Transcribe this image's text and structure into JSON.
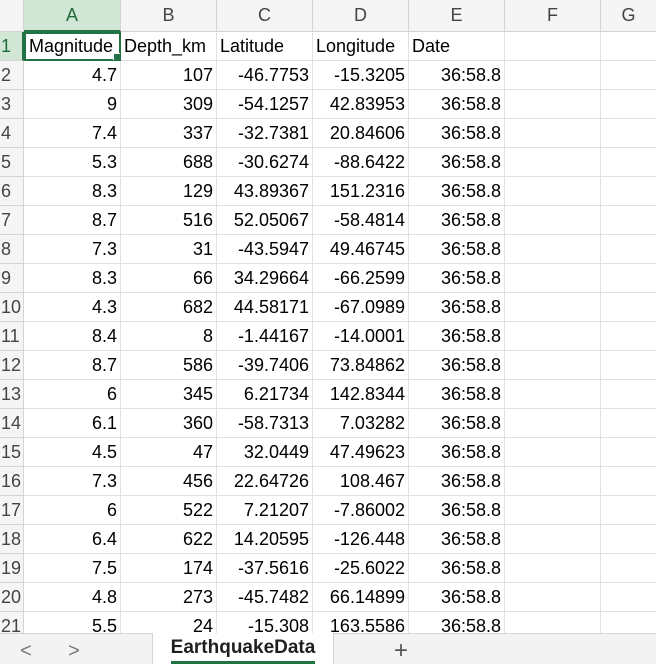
{
  "columns": [
    "A",
    "B",
    "C",
    "D",
    "E",
    "F",
    "G"
  ],
  "row_numbers": [
    "1",
    "2",
    "3",
    "4",
    "5",
    "6",
    "7",
    "8",
    "9",
    "10",
    "11",
    "12",
    "13",
    "14",
    "15",
    "16",
    "17",
    "18",
    "19",
    "20",
    "21"
  ],
  "headers": [
    "Magnitude",
    "Depth_km",
    "Latitude",
    "Longitude",
    "Date"
  ],
  "rows": [
    [
      "4.7",
      "107",
      "-46.7753",
      "-15.3205",
      "36:58.8"
    ],
    [
      "9",
      "309",
      "-54.1257",
      "42.83953",
      "36:58.8"
    ],
    [
      "7.4",
      "337",
      "-32.7381",
      "20.84606",
      "36:58.8"
    ],
    [
      "5.3",
      "688",
      "-30.6274",
      "-88.6422",
      "36:58.8"
    ],
    [
      "8.3",
      "129",
      "43.89367",
      "151.2316",
      "36:58.8"
    ],
    [
      "8.7",
      "516",
      "52.05067",
      "-58.4814",
      "36:58.8"
    ],
    [
      "7.3",
      "31",
      "-43.5947",
      "49.46745",
      "36:58.8"
    ],
    [
      "8.3",
      "66",
      "34.29664",
      "-66.2599",
      "36:58.8"
    ],
    [
      "4.3",
      "682",
      "44.58171",
      "-67.0989",
      "36:58.8"
    ],
    [
      "8.4",
      "8",
      "-1.44167",
      "-14.0001",
      "36:58.8"
    ],
    [
      "8.7",
      "586",
      "-39.7406",
      "73.84862",
      "36:58.8"
    ],
    [
      "6",
      "345",
      "6.21734",
      "142.8344",
      "36:58.8"
    ],
    [
      "6.1",
      "360",
      "-58.7313",
      "7.03282",
      "36:58.8"
    ],
    [
      "4.5",
      "47",
      "32.0449",
      "47.49623",
      "36:58.8"
    ],
    [
      "7.3",
      "456",
      "22.64726",
      "108.467",
      "36:58.8"
    ],
    [
      "6",
      "522",
      "7.21207",
      "-7.86002",
      "36:58.8"
    ],
    [
      "6.4",
      "622",
      "14.20595",
      "-126.448",
      "36:58.8"
    ],
    [
      "7.5",
      "174",
      "-37.5616",
      "-25.6022",
      "36:58.8"
    ],
    [
      "4.8",
      "273",
      "-45.7482",
      "66.14899",
      "36:58.8"
    ],
    [
      "5.5",
      "24",
      "-15.308",
      "163.5586",
      "36:58.8"
    ]
  ],
  "sheet_tab": "EarthquakeData",
  "nav": {
    "prev": "<",
    "next": ">",
    "add": "+"
  },
  "colors": {
    "accent": "#217346",
    "selected_header": "#d2e6d6"
  }
}
